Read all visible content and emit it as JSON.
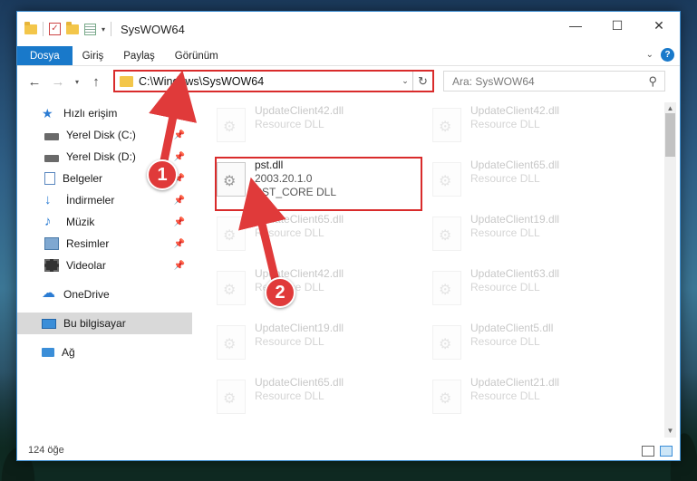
{
  "window": {
    "title": "SysWOW64",
    "controls": {
      "minimize": "—",
      "maximize": "☐",
      "close": "✕"
    }
  },
  "ribbon": {
    "tabs": [
      "Dosya",
      "Giriş",
      "Paylaş",
      "Görünüm"
    ],
    "active_tab": "Dosya"
  },
  "navbar": {
    "address": "C:\\Windows\\SysWOW64",
    "search_placeholder": "Ara: SysWOW64"
  },
  "sidebar": {
    "quick_access": "Hızlı erişim",
    "items": [
      {
        "label": "Yerel Disk (C:)",
        "icon": "drive-icon"
      },
      {
        "label": "Yerel Disk (D:)",
        "icon": "drive-icon"
      },
      {
        "label": "Belgeler",
        "icon": "documents-icon"
      },
      {
        "label": "İndirmeler",
        "icon": "download-icon"
      },
      {
        "label": "Müzik",
        "icon": "music-icon"
      },
      {
        "label": "Resimler",
        "icon": "pictures-icon"
      },
      {
        "label": "Videolar",
        "icon": "video-icon"
      }
    ],
    "onedrive": "OneDrive",
    "this_pc": "Bu bilgisayar",
    "network": "Ağ"
  },
  "files": {
    "left": [
      {
        "name": "UpdateClient42.dll",
        "desc": "Resource DLL"
      },
      {
        "name": "pst.dll",
        "version": "2003.20.1.0",
        "desc": "PST_CORE DLL"
      },
      {
        "name": "UpdateClient65.dll",
        "desc": "Resource DLL"
      },
      {
        "name": "UpdateClient42.dll",
        "desc": "Resource DLL"
      },
      {
        "name": "UpdateClient19.dll",
        "desc": "Resource DLL"
      },
      {
        "name": "UpdateClient65.dll",
        "desc": "Resource DLL"
      }
    ],
    "right": [
      {
        "name": "UpdateClient42.dll",
        "desc": "Resource DLL"
      },
      {
        "name": "UpdateClient65.dll",
        "desc": "Resource DLL"
      },
      {
        "name": "UpdateClient19.dll",
        "desc": "Resource DLL"
      },
      {
        "name": "UpdateClient63.dll",
        "desc": "Resource DLL"
      },
      {
        "name": "UpdateClient5.dll",
        "desc": "Resource DLL"
      },
      {
        "name": "UpdateClient21.dll",
        "desc": "Resource DLL"
      }
    ]
  },
  "status": {
    "item_count": "124 öğe"
  },
  "annotations": {
    "badge1": "1",
    "badge2": "2",
    "color": "#e03a3a"
  }
}
